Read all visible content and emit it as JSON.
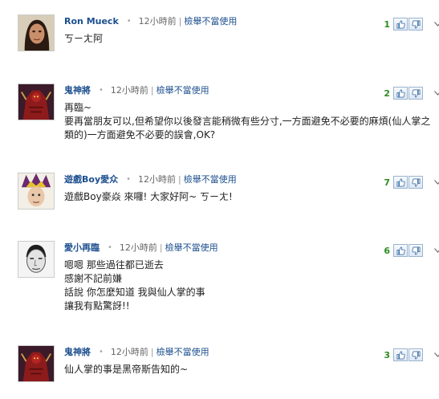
{
  "comments": [
    {
      "author": "Ron Mueck",
      "time": "12小時前",
      "report": "檢舉不當使用",
      "votes": "1",
      "lines": [
        "ㄎㄧㄤ阿"
      ],
      "avatar": "ron-mueck-avatar"
    },
    {
      "author": "鬼神將",
      "time": "12小時前",
      "report": "檢舉不當使用",
      "votes": "2",
      "lines": [
        "再臨~",
        "要再當朋友可以,但希望你以後發言能稍微有些分寸,一方面避免不必要的麻煩(仙人掌之類的)一方面避免不必要的誤會,OK?"
      ],
      "avatar": "demon-avatar"
    },
    {
      "author": "遊戲Boy愛众",
      "time": "12小時前",
      "report": "檢舉不當使用",
      "votes": "7",
      "lines": [
        "遊戲Boy豪焱 來囉! 大家好阿~ ㄎㄧㄤ!"
      ],
      "avatar": "yugi-avatar"
    },
    {
      "author": "愛小再臨",
      "time": "12小時前",
      "report": "檢舉不當使用",
      "votes": "6",
      "lines": [
        "嗯嗯 那些過往都已逝去",
        "感謝不記前嫌",
        "話說 你怎麼知道 我與仙人掌的事",
        "讓我有點驚訝!!"
      ],
      "avatar": "face-avatar"
    },
    {
      "author": "鬼神將",
      "time": "12小時前",
      "report": "檢舉不當使用",
      "votes": "3",
      "lines": [
        "仙人掌的事是黑帝斯告知的~"
      ],
      "avatar": "demon-avatar"
    }
  ],
  "colors": {
    "author": "#1c4f8f",
    "vote_count": "#2e8b21"
  },
  "icons": [
    "thumbs-up-icon",
    "thumbs-down-icon",
    "chevron-down-icon"
  ]
}
